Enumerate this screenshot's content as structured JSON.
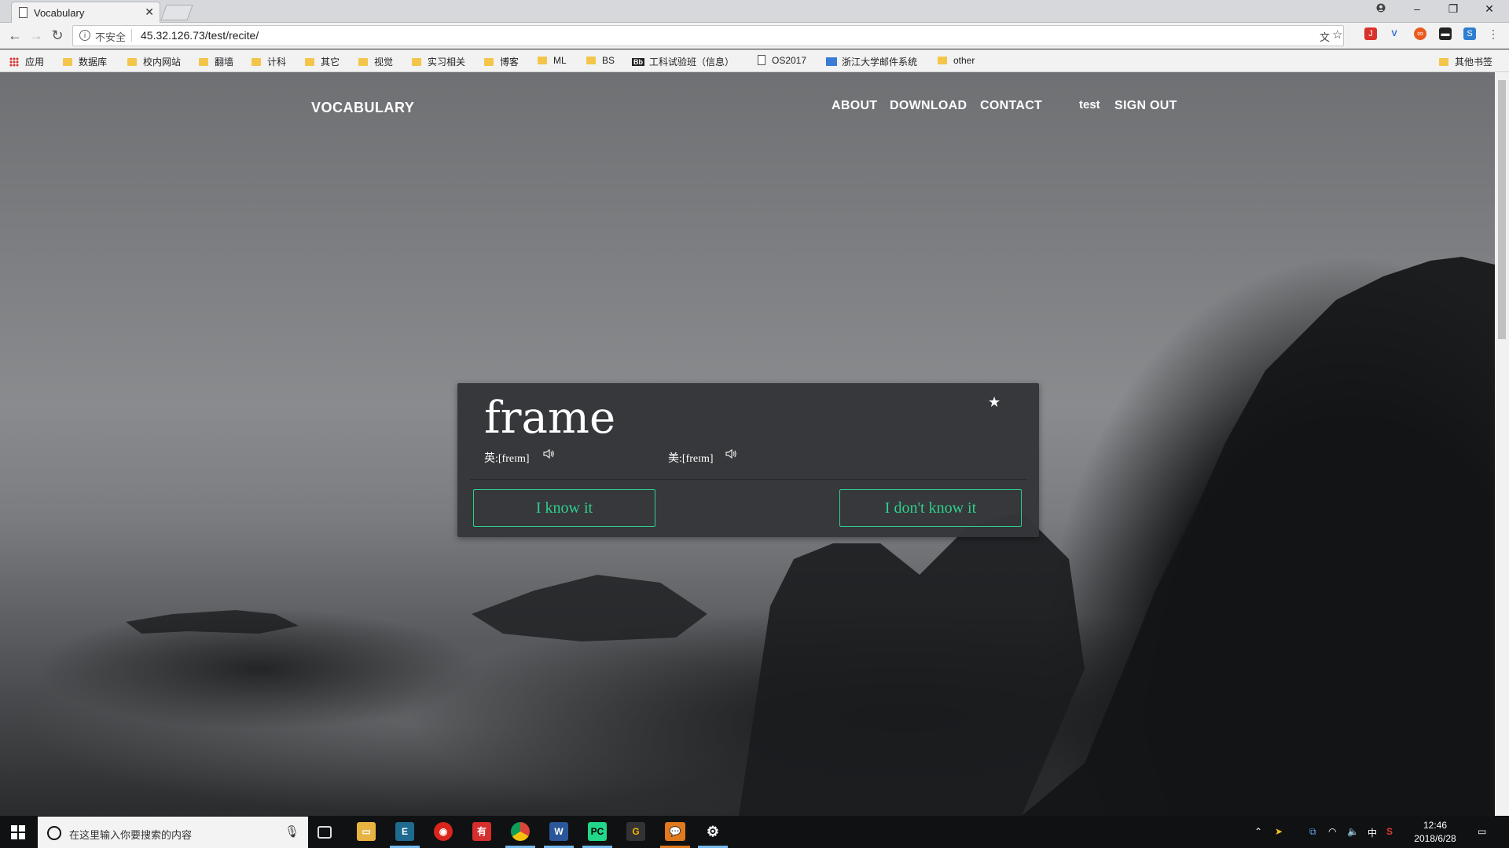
{
  "browser": {
    "tab_title": "Vocabulary",
    "tab_close": "✕",
    "security_label": "不安全",
    "url": "45.32.126.73/test/recite/",
    "bookmarks": [
      {
        "label": "应用",
        "icon": "apps-icon"
      },
      {
        "label": "数据库",
        "icon": "folder-icon"
      },
      {
        "label": "校内网站",
        "icon": "folder-icon"
      },
      {
        "label": "翻墙",
        "icon": "folder-icon"
      },
      {
        "label": "计科",
        "icon": "folder-icon"
      },
      {
        "label": "其它",
        "icon": "folder-icon"
      },
      {
        "label": "视觉",
        "icon": "folder-icon"
      },
      {
        "label": "实习相关",
        "icon": "folder-icon"
      },
      {
        "label": "博客",
        "icon": "folder-icon"
      },
      {
        "label": "ML",
        "icon": "folder-icon"
      },
      {
        "label": "BS",
        "icon": "folder-icon"
      },
      {
        "label": "工科试验班（信息）",
        "icon": "bb-icon"
      },
      {
        "label": "OS2017",
        "icon": "page-icon"
      },
      {
        "label": "浙江大学邮件系统",
        "icon": "mail-icon"
      },
      {
        "label": "other",
        "icon": "folder-icon"
      }
    ],
    "other_bookmarks": "其他书签"
  },
  "site": {
    "brand": "VOCABULARY",
    "nav": {
      "about": "ABOUT",
      "download": "DOWNLOAD",
      "contact": "CONTACT",
      "user": "test",
      "sign_out": "SIGN OUT"
    },
    "accent_color": "#2fcf8c"
  },
  "card": {
    "word": "frame",
    "uk_phonetic": "英:[freɪm]",
    "us_phonetic": "美:[freɪm]",
    "know_label": "I know it",
    "dont_know_label": "I don't know it"
  },
  "taskbar": {
    "search_placeholder": "在这里输入你要搜索的内容",
    "ime": "中",
    "time": "12:46",
    "date": "2018/6/28"
  }
}
